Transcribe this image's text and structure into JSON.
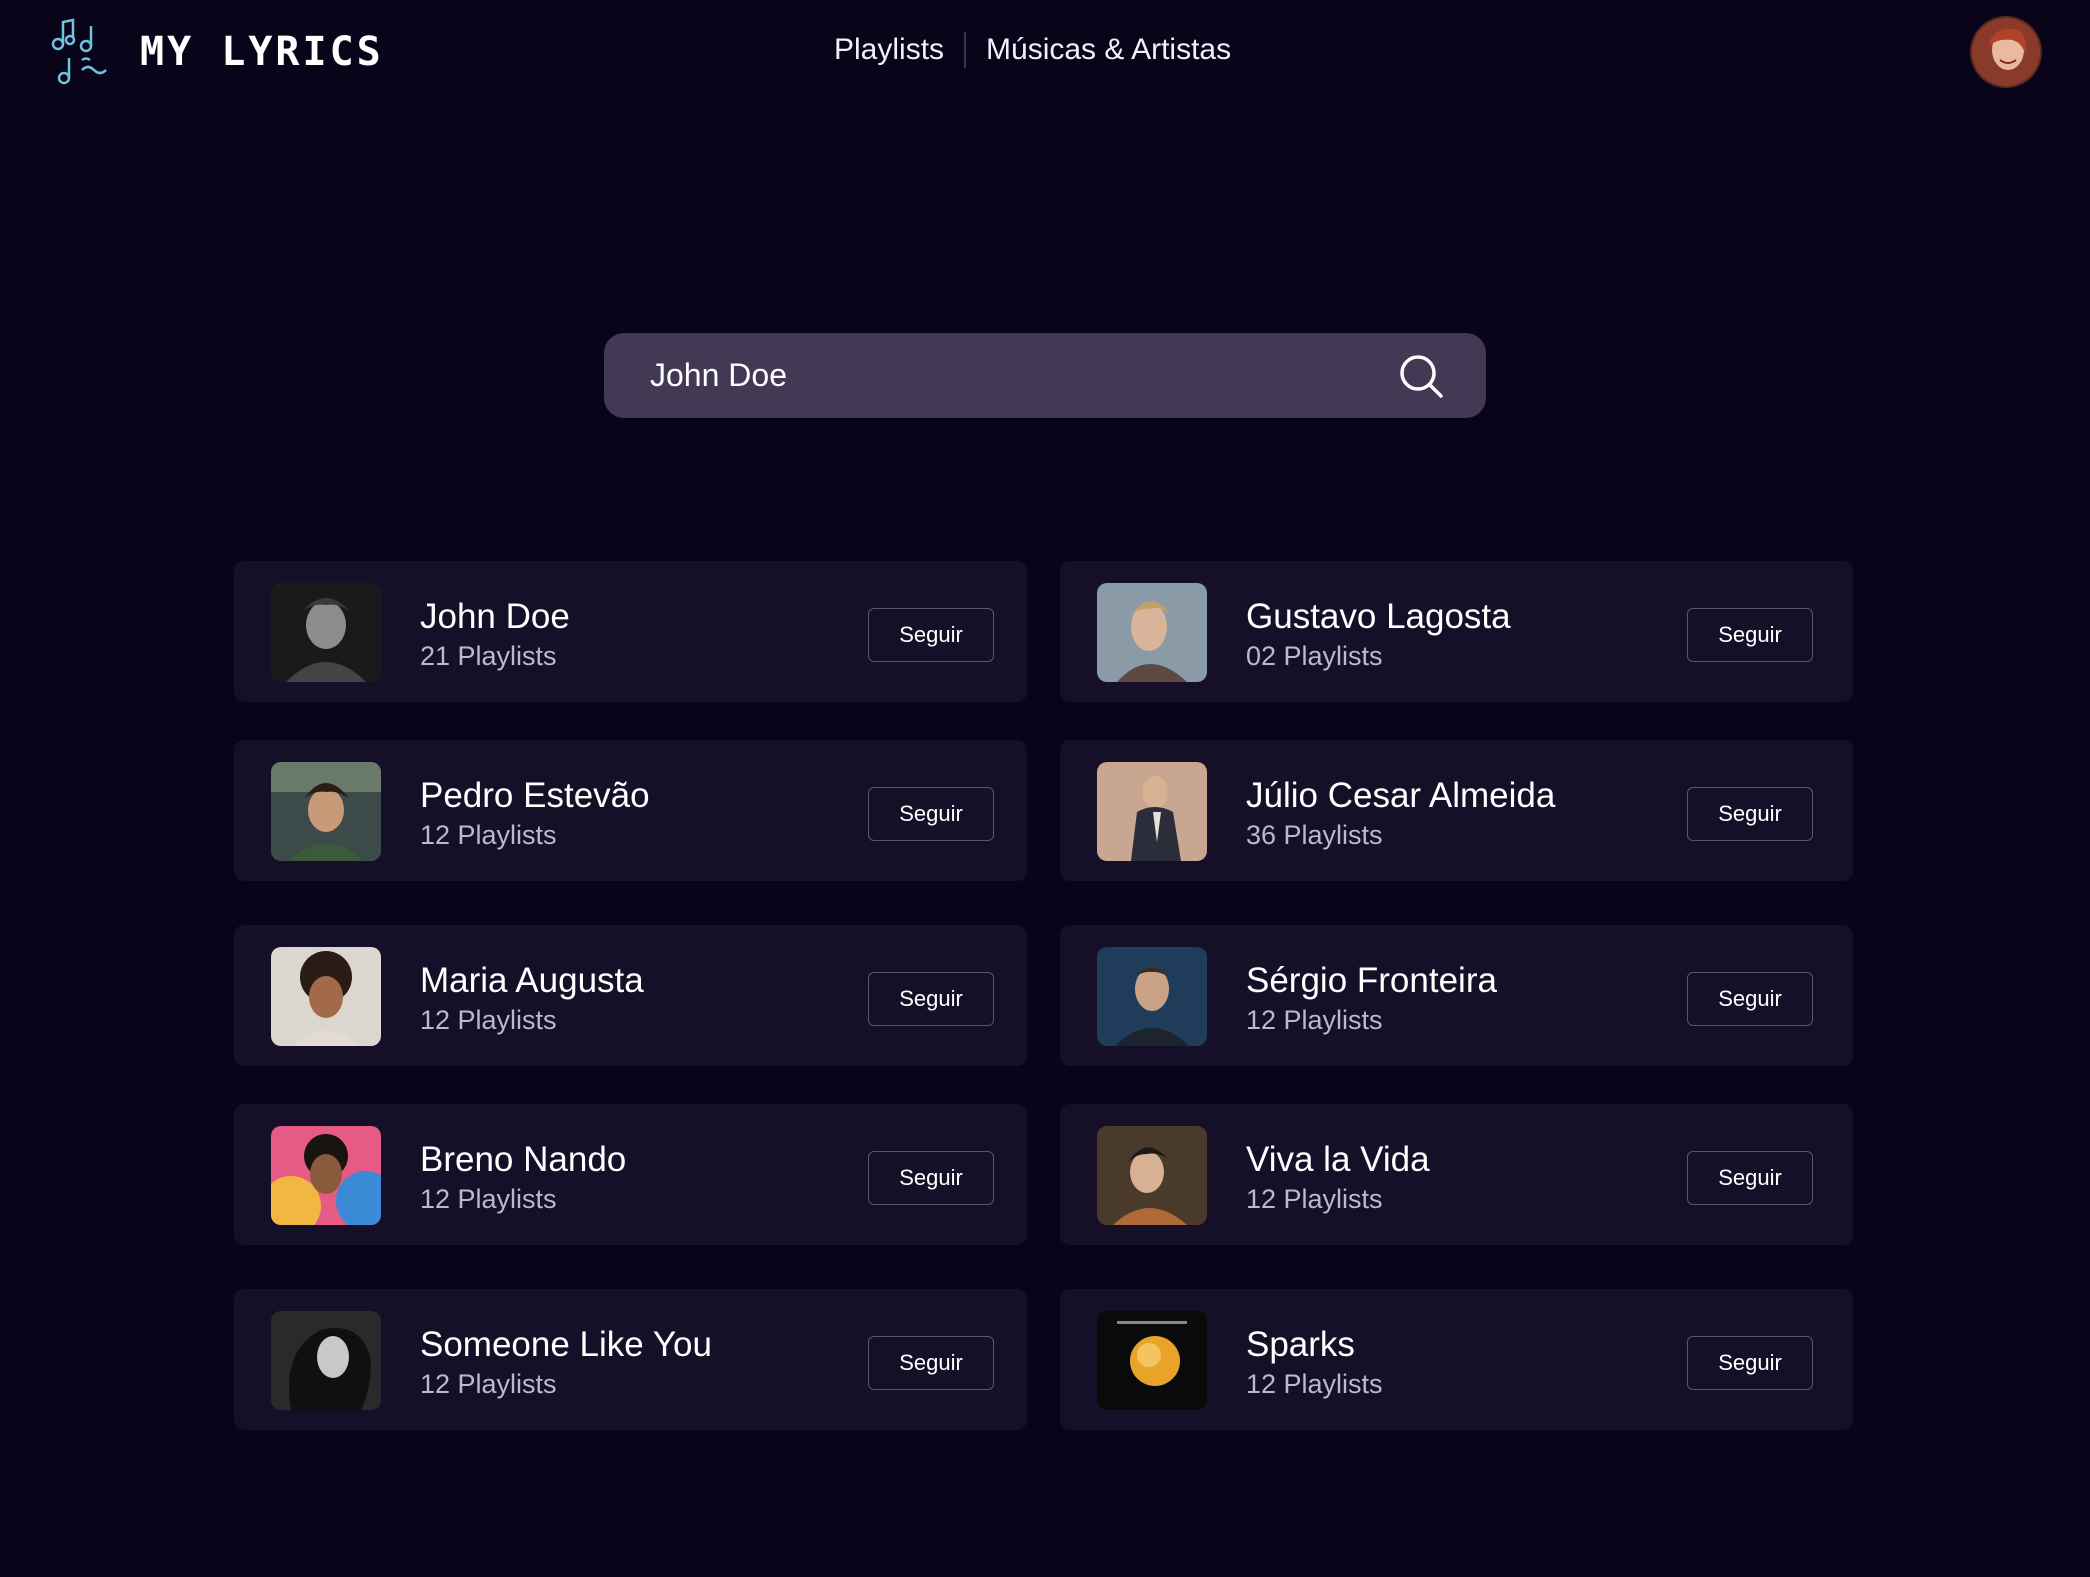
{
  "header": {
    "logo_text": "MY LYRICS",
    "nav": [
      "Playlists",
      "Músicas & Artistas"
    ]
  },
  "search": {
    "value": "John Doe"
  },
  "results": [
    {
      "name": "John Doe",
      "count": "21 Playlists",
      "button": "Seguir"
    },
    {
      "name": "Gustavo Lagosta",
      "count": "02 Playlists",
      "button": "Seguir"
    },
    {
      "name": "Pedro Estevão",
      "count": "12 Playlists",
      "button": "Seguir"
    },
    {
      "name": "Júlio Cesar Almeida",
      "count": "36 Playlists",
      "button": "Seguir"
    },
    {
      "name": "Maria Augusta",
      "count": "12 Playlists",
      "button": "Seguir"
    },
    {
      "name": "Sérgio Fronteira",
      "count": "12 Playlists",
      "button": "Seguir"
    },
    {
      "name": "Breno Nando",
      "count": "12 Playlists",
      "button": "Seguir"
    },
    {
      "name": "Viva la Vida",
      "count": "12 Playlists",
      "button": "Seguir"
    },
    {
      "name": "Someone Like You",
      "count": "12 Playlists",
      "button": "Seguir"
    },
    {
      "name": "Sparks",
      "count": "12 Playlists",
      "button": "Seguir"
    }
  ],
  "colors": {
    "background": "#090419",
    "card": "#151028",
    "search": "#423955",
    "logo_accent": "#6fc3de"
  }
}
